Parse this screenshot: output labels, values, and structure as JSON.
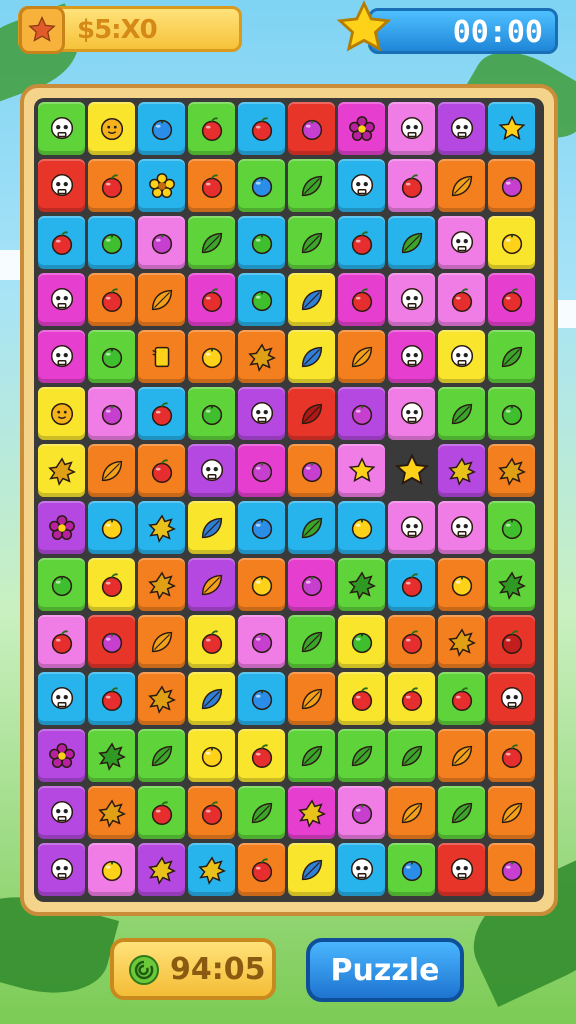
{
  "header": {
    "coin_label": "$5:X0",
    "timer": "00:00"
  },
  "footer": {
    "score": "94:05",
    "puzzle_label": "Puzzle"
  },
  "palette": {
    "green": "#5fd33a",
    "yellow": "#f8e52c",
    "blue": "#27b3ec",
    "red": "#e8352a",
    "orange": "#f47f1f",
    "pink": "#f07de6",
    "purple": "#b548e0",
    "magenta": "#e63fd0",
    "empty": ""
  },
  "icon_colors": {
    "skull": "#ffffff",
    "fruit": "#e62e2e",
    "berry": "#c63fcf",
    "lime": "#3fbf2e",
    "plum": "#2a8ee8",
    "lemon": "#ffd21a",
    "leaf": "#ffd21a",
    "star": "#ffd21a",
    "splat": "#ffd21a",
    "flower": "#b7209f"
  },
  "board": [
    [
      [
        "green",
        "skull"
      ],
      [
        "yellow",
        "sun"
      ],
      [
        "blue",
        "plum"
      ],
      [
        "green",
        "fruit"
      ],
      [
        "blue",
        "fruit"
      ],
      [
        "red",
        "berry"
      ],
      [
        "magenta",
        "flower"
      ],
      [
        "pink",
        "skull"
      ],
      [
        "purple",
        "skull"
      ],
      [
        "blue",
        "star"
      ]
    ],
    [
      [
        "red",
        "skull"
      ],
      [
        "orange",
        "fruit"
      ],
      [
        "blue",
        "flower"
      ],
      [
        "orange",
        "fruit"
      ],
      [
        "green",
        "plum"
      ],
      [
        "green",
        "leaf"
      ],
      [
        "blue",
        "skull"
      ],
      [
        "pink",
        "fruit"
      ],
      [
        "orange",
        "leaf"
      ],
      [
        "orange",
        "berry"
      ]
    ],
    [
      [
        "blue",
        "fruit"
      ],
      [
        "blue",
        "lime"
      ],
      [
        "pink",
        "berry"
      ],
      [
        "green",
        "leaf"
      ],
      [
        "blue",
        "lime"
      ],
      [
        "green",
        "leaf"
      ],
      [
        "blue",
        "fruit"
      ],
      [
        "blue",
        "leaf"
      ],
      [
        "pink",
        "skull"
      ],
      [
        "yellow",
        "lemon"
      ]
    ],
    [
      [
        "magenta",
        "skull"
      ],
      [
        "orange",
        "fruit"
      ],
      [
        "orange",
        "leaf"
      ],
      [
        "magenta",
        "fruit"
      ],
      [
        "blue",
        "lime"
      ],
      [
        "yellow",
        "leaf"
      ],
      [
        "magenta",
        "fruit"
      ],
      [
        "pink",
        "skull"
      ],
      [
        "pink",
        "fruit"
      ],
      [
        "magenta",
        "fruit"
      ]
    ],
    [
      [
        "magenta",
        "skull"
      ],
      [
        "green",
        "lime"
      ],
      [
        "orange",
        "note"
      ],
      [
        "orange",
        "lemon"
      ],
      [
        "orange",
        "splat"
      ],
      [
        "yellow",
        "leaf"
      ],
      [
        "orange",
        "leaf"
      ],
      [
        "magenta",
        "skull"
      ],
      [
        "yellow",
        "skull"
      ],
      [
        "green",
        "leaf"
      ]
    ],
    [
      [
        "yellow",
        "sun"
      ],
      [
        "pink",
        "berry"
      ],
      [
        "blue",
        "fruit"
      ],
      [
        "green",
        "lime"
      ],
      [
        "purple",
        "skull"
      ],
      [
        "red",
        "leaf"
      ],
      [
        "purple",
        "berry"
      ],
      [
        "pink",
        "skull"
      ],
      [
        "green",
        "leaf"
      ],
      [
        "green",
        "lime"
      ]
    ],
    [
      [
        "yellow",
        "splat"
      ],
      [
        "orange",
        "leaf"
      ],
      [
        "orange",
        "fruit"
      ],
      [
        "purple",
        "skull"
      ],
      [
        "magenta",
        "berry"
      ],
      [
        "orange",
        "berry"
      ],
      [
        "pink",
        "star"
      ],
      [
        "empty",
        "star"
      ],
      [
        "purple",
        "splat"
      ],
      [
        "orange",
        "splat"
      ]
    ],
    [
      [
        "purple",
        "flower"
      ],
      [
        "blue",
        "lemon"
      ],
      [
        "blue",
        "splat"
      ],
      [
        "yellow",
        "leaf"
      ],
      [
        "blue",
        "plum"
      ],
      [
        "blue",
        "leaf"
      ],
      [
        "blue",
        "lemon"
      ],
      [
        "pink",
        "skull"
      ],
      [
        "pink",
        "skull"
      ],
      [
        "green",
        "lime"
      ]
    ],
    [
      [
        "green",
        "lime"
      ],
      [
        "yellow",
        "fruit"
      ],
      [
        "orange",
        "splat"
      ],
      [
        "purple",
        "leaf"
      ],
      [
        "orange",
        "lemon"
      ],
      [
        "magenta",
        "berry"
      ],
      [
        "green",
        "splat"
      ],
      [
        "blue",
        "fruit"
      ],
      [
        "orange",
        "lemon"
      ],
      [
        "green",
        "splat"
      ]
    ],
    [
      [
        "pink",
        "fruit"
      ],
      [
        "red",
        "berry"
      ],
      [
        "orange",
        "leaf"
      ],
      [
        "yellow",
        "fruit"
      ],
      [
        "pink",
        "berry"
      ],
      [
        "green",
        "leaf"
      ],
      [
        "yellow",
        "lime"
      ],
      [
        "orange",
        "fruit"
      ],
      [
        "orange",
        "splat"
      ],
      [
        "red",
        "fruit"
      ]
    ],
    [
      [
        "blue",
        "skull"
      ],
      [
        "blue",
        "fruit"
      ],
      [
        "orange",
        "splat"
      ],
      [
        "yellow",
        "leaf"
      ],
      [
        "blue",
        "plum"
      ],
      [
        "orange",
        "leaf"
      ],
      [
        "yellow",
        "fruit"
      ],
      [
        "yellow",
        "fruit"
      ],
      [
        "green",
        "fruit"
      ],
      [
        "red",
        "skull"
      ]
    ],
    [
      [
        "purple",
        "flower"
      ],
      [
        "green",
        "splat"
      ],
      [
        "green",
        "leaf"
      ],
      [
        "yellow",
        "lemon"
      ],
      [
        "yellow",
        "fruit"
      ],
      [
        "green",
        "leaf"
      ],
      [
        "green",
        "leaf"
      ],
      [
        "green",
        "leaf"
      ],
      [
        "orange",
        "leaf"
      ],
      [
        "orange",
        "fruit"
      ]
    ],
    [
      [
        "purple",
        "skull"
      ],
      [
        "orange",
        "splat"
      ],
      [
        "green",
        "fruit"
      ],
      [
        "orange",
        "fruit"
      ],
      [
        "green",
        "leaf"
      ],
      [
        "magenta",
        "splat"
      ],
      [
        "pink",
        "berry"
      ],
      [
        "orange",
        "leaf"
      ],
      [
        "green",
        "leaf"
      ],
      [
        "orange",
        "leaf"
      ]
    ],
    [
      [
        "purple",
        "skull"
      ],
      [
        "pink",
        "lemon"
      ],
      [
        "purple",
        "splat"
      ],
      [
        "blue",
        "splat"
      ],
      [
        "orange",
        "fruit"
      ],
      [
        "yellow",
        "leaf"
      ],
      [
        "blue",
        "skull"
      ],
      [
        "green",
        "plum"
      ],
      [
        "red",
        "skull"
      ],
      [
        "orange",
        "berry"
      ]
    ]
  ]
}
